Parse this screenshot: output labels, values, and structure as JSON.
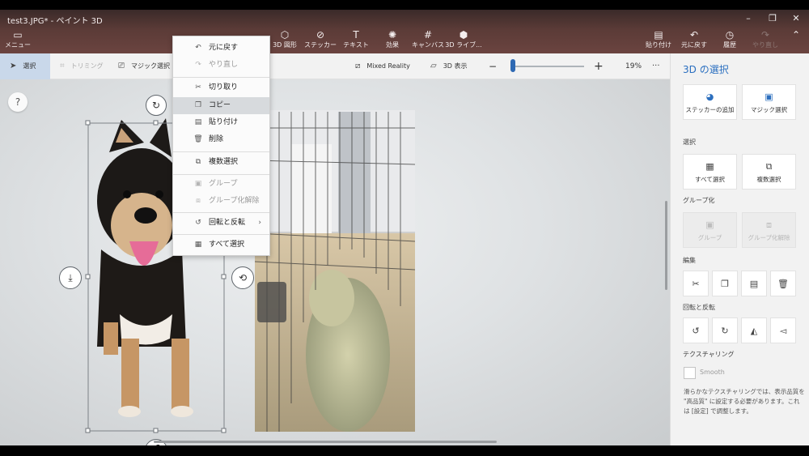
{
  "window": {
    "title": "test3.JPG* - ペイント 3D",
    "controls": {
      "minimize": "–",
      "maximize": "❐",
      "close": "✕"
    }
  },
  "ribbon": {
    "menu": {
      "icon": "folder-icon",
      "label": "メニュー"
    },
    "items": [
      {
        "name": "3d-shapes",
        "icon": "cube-icon",
        "label": "3D 図形"
      },
      {
        "name": "stickers",
        "icon": "sticker-icon",
        "label": "ステッカー"
      },
      {
        "name": "text",
        "icon": "text-icon",
        "label": "テキスト"
      },
      {
        "name": "effects",
        "icon": "effects-icon",
        "label": "効果"
      },
      {
        "name": "canvas",
        "icon": "canvas-icon",
        "label": "キャンバス"
      },
      {
        "name": "3d-library",
        "icon": "library-icon",
        "label": "3D ライブ..."
      }
    ],
    "right": [
      {
        "name": "paste",
        "icon": "paste-icon",
        "label": "貼り付け",
        "disabled": false
      },
      {
        "name": "undo",
        "icon": "undo-icon",
        "label": "元に戻す",
        "disabled": false
      },
      {
        "name": "history",
        "icon": "history-icon",
        "label": "履歴",
        "disabled": false
      },
      {
        "name": "redo",
        "icon": "redo-icon",
        "label": "やり直し",
        "disabled": true
      }
    ]
  },
  "toolbar": {
    "select": "選択",
    "crop": "トリミング",
    "magic_select": "マジック選択",
    "mixed_reality": "Mixed Reality",
    "view_3d": "3D 表示",
    "zoom_minus": "−",
    "zoom_plus": "+",
    "zoom_value": "19%",
    "zoom_fraction": 0.03,
    "more": "···"
  },
  "canvas": {
    "help": "?",
    "selection_handles": {
      "rotate": "↻",
      "left": "⤓",
      "right": "⟲",
      "bottom": "↺"
    }
  },
  "context_menu": {
    "items": [
      {
        "icon": "undo-icon",
        "label": "元に戻す",
        "disabled": false
      },
      {
        "icon": "redo-icon",
        "label": "やり直し",
        "disabled": true
      },
      {
        "icon": "cut-icon",
        "label": "切り取り",
        "disabled": false
      },
      {
        "icon": "copy-icon",
        "label": "コピー",
        "disabled": false,
        "highlighted": true
      },
      {
        "icon": "paste-icon",
        "label": "貼り付け",
        "disabled": false
      },
      {
        "icon": "delete-icon",
        "label": "削除",
        "disabled": false
      },
      {
        "icon": "multi-select-icon",
        "label": "複数選択",
        "disabled": false
      },
      {
        "icon": "group-icon",
        "label": "グループ",
        "disabled": true
      },
      {
        "icon": "ungroup-icon",
        "label": "グループ化解除",
        "disabled": true
      },
      {
        "icon": "rotate-icon",
        "label": "回転と反転",
        "disabled": false,
        "submenu": "›"
      },
      {
        "icon": "select-all-icon",
        "label": "すべて選択",
        "disabled": false
      }
    ]
  },
  "panel": {
    "title": "3D の選択",
    "top_buttons": [
      {
        "icon": "sticker-icon",
        "label": "ステッカーの追加",
        "disabled": false
      },
      {
        "icon": "magic-select-icon",
        "label": "マジック選択",
        "disabled": false
      }
    ],
    "select_section": {
      "title": "選択",
      "buttons": [
        {
          "icon": "select-all-icon",
          "label": "すべて選択",
          "disabled": false
        },
        {
          "icon": "multi-select-icon",
          "label": "複数選択",
          "disabled": false
        }
      ]
    },
    "group_section": {
      "title": "グループ化",
      "buttons": [
        {
          "icon": "group-icon",
          "label": "グループ",
          "disabled": true
        },
        {
          "icon": "ungroup-icon",
          "label": "グループ化解除",
          "disabled": true
        }
      ]
    },
    "edit_section": {
      "title": "編集",
      "buttons": [
        {
          "icon": "cut-icon"
        },
        {
          "icon": "copy-icon"
        },
        {
          "icon": "paste-icon"
        },
        {
          "icon": "delete-icon"
        }
      ]
    },
    "rotate_section": {
      "title": "回転と反転",
      "buttons": [
        {
          "icon": "rotate-left-icon"
        },
        {
          "icon": "rotate-right-icon"
        },
        {
          "icon": "flip-horizontal-icon"
        },
        {
          "icon": "flip-vertical-icon"
        }
      ]
    },
    "texture_section": {
      "title": "テクスチャリング",
      "smooth_label": "Smooth",
      "smooth_checked": false,
      "note": "滑らかなテクスチャリングでは、表示品質を \"高品質\" に設定する必要があります。これは [設定] で調整します。"
    }
  }
}
